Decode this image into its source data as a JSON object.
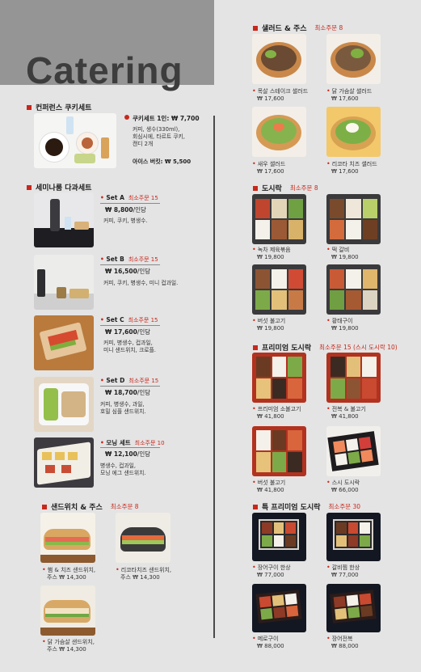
{
  "header": {
    "title": "Catering"
  },
  "conference": {
    "heading": "컨퍼런스 쿠키세트",
    "set_label": "쿠키세트 1인: ₩ 7,700",
    "desc_lines": [
      "커피, 생수(330ml),",
      "회심시에, 타르트 쿠키,",
      "캔디 2개"
    ],
    "extra": "아이스 버킷: ₩ 5,500"
  },
  "seminar": {
    "heading": "세미나룸 다과세트",
    "min_label": "최소주문 15",
    "sets": [
      {
        "name": "Set A",
        "price": "₩ 8,800",
        "unit": "/인당",
        "desc": [
          "커피, 쿠키, 병생수."
        ],
        "min": "최소주문 15"
      },
      {
        "name": "Set B",
        "price": "₩ 16,500",
        "unit": "/인당",
        "desc": [
          "커피, 쿠키, 병생수, 미니 컵과일."
        ],
        "min": "최소주문 15"
      },
      {
        "name": "Set C",
        "price": "₩ 17,600",
        "unit": "/인당",
        "desc": [
          "커피, 병생수, 컵과일,",
          "미니 샌드위치, 크로플."
        ],
        "min": "최소주문 15"
      },
      {
        "name": "Set D",
        "price": "₩ 18,700",
        "unit": "/인당",
        "desc": [
          "커피, 병생수, 과일,",
          "호밀 심플 샌드위치."
        ],
        "min": "최소주문 15"
      },
      {
        "name": "모닝 세트",
        "price": "₩ 12,100",
        "unit": "/인당",
        "desc": [
          "병생수, 컵과일,",
          "모닝 에그 샌드위치."
        ],
        "min": "최소주문 10"
      }
    ]
  },
  "sandwich": {
    "heading": "샌드위치 & 주스",
    "min": "최소주문 8",
    "items": [
      {
        "name": "햄 & 치즈 샌드위치,",
        "sub": "주스 ₩ 14,300"
      },
      {
        "name": "리코타치즈 샌드위치,",
        "sub": "주스 ₩ 14,300"
      },
      {
        "name": "닭 가슴살 샌드위치,",
        "sub": "주스 ₩ 14,300"
      }
    ]
  },
  "salad": {
    "heading": "샐러드 & 주스",
    "min": "최소주문 8",
    "items": [
      {
        "name": "목살 스테이크 샐러드",
        "price": "₩ 17,600"
      },
      {
        "name": "닭 가슴살 샐러드",
        "price": "₩ 17,600"
      },
      {
        "name": "새우 샐러드",
        "price": "₩ 17,600"
      },
      {
        "name": "리코타 치즈 샐러드",
        "price": "₩ 17,600"
      }
    ]
  },
  "dosirak": {
    "heading": "도시락",
    "min": "최소주문 8",
    "items": [
      {
        "name": "녹차 제육볶음",
        "price": "₩ 19,800"
      },
      {
        "name": "떡 갈비",
        "price": "₩ 19,800"
      },
      {
        "name": "버섯 불고기",
        "price": "₩ 19,800"
      },
      {
        "name": "황태구이",
        "price": "₩ 19,800"
      }
    ]
  },
  "premium": {
    "heading": "프리미엄 도시락",
    "min": "최소주문 15 (스시 도시락 10)",
    "items": [
      {
        "name": "프리미엄 소불고기",
        "price": "₩ 41,800"
      },
      {
        "name": "전복 & 불고기",
        "price": "₩ 41,800"
      },
      {
        "name": "버섯 불고기",
        "price": "₩ 41,800"
      },
      {
        "name": "스시 도시락",
        "price": "₩ 66,000"
      }
    ]
  },
  "special": {
    "heading": "특 프리미엄 도시락",
    "min": "최소주문 30",
    "items": [
      {
        "name": "장어구이 한상",
        "price": "₩ 77,000"
      },
      {
        "name": "갈비찜 한상",
        "price": "₩ 77,000"
      },
      {
        "name": "메로구이",
        "price": "₩ 88,000"
      },
      {
        "name": "장어전복",
        "price": "₩ 88,000"
      }
    ]
  },
  "colors": {
    "accent": "#c8281c",
    "header_band": "#959595",
    "background": "#e4e4e4"
  }
}
